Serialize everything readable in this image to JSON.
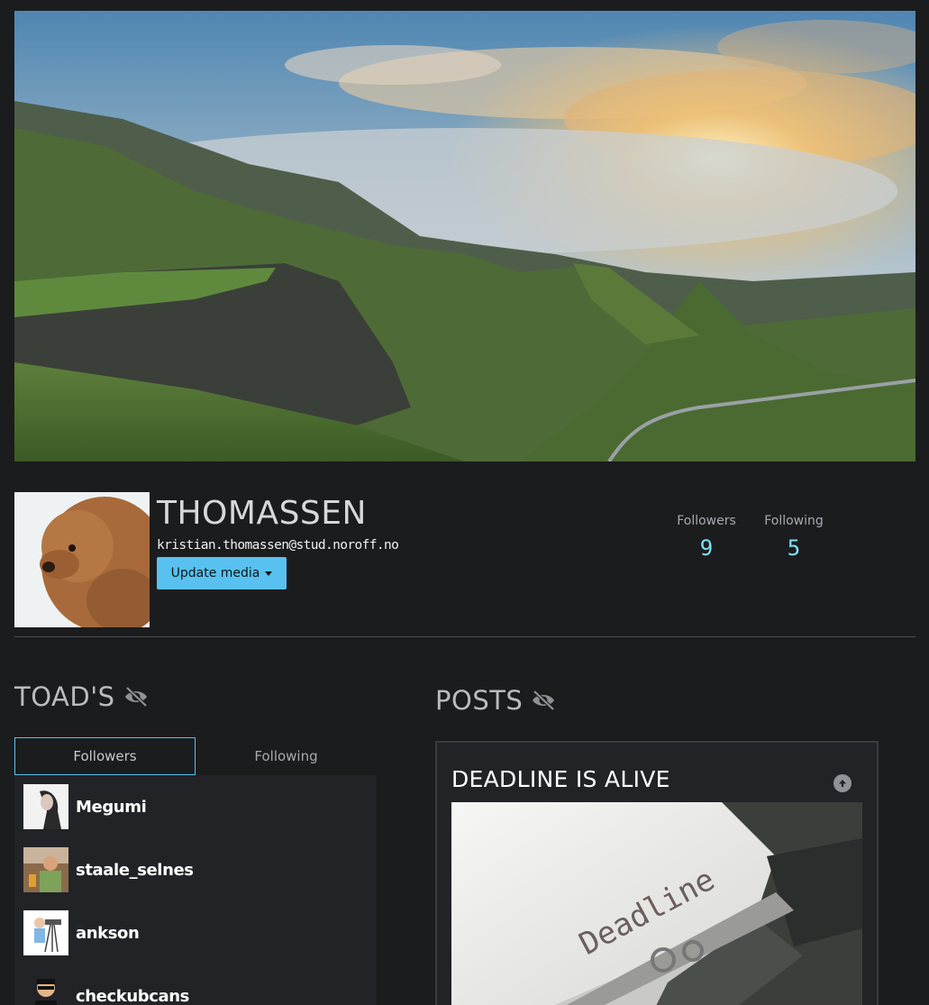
{
  "profile": {
    "name": "THOMASSEN",
    "email": "kristian.thomassen@stud.noroff.no",
    "update_media_label": "Update media"
  },
  "stats": {
    "followers_label": "Followers",
    "followers_count": "9",
    "following_label": "Following",
    "following_count": "5"
  },
  "toads": {
    "title": "TOAD'S",
    "tabs": [
      {
        "label": "Followers",
        "active": true
      },
      {
        "label": "Following",
        "active": false
      }
    ],
    "users": [
      {
        "name": "Megumi"
      },
      {
        "name": "staale_selnes"
      },
      {
        "name": "ankson"
      },
      {
        "name": "checkubcans"
      }
    ]
  },
  "posts": {
    "title": "POSTS",
    "items": [
      {
        "title": "DEADLINE IS ALIVE",
        "image_text": "Deadline"
      }
    ]
  },
  "colors": {
    "background": "#1b1c1e",
    "accent": "#58c1ef",
    "stat_value": "#7fe0f2"
  },
  "icons": {
    "visibility": "eye-slash-icon",
    "scroll_up": "arrow-up-circle-icon"
  }
}
